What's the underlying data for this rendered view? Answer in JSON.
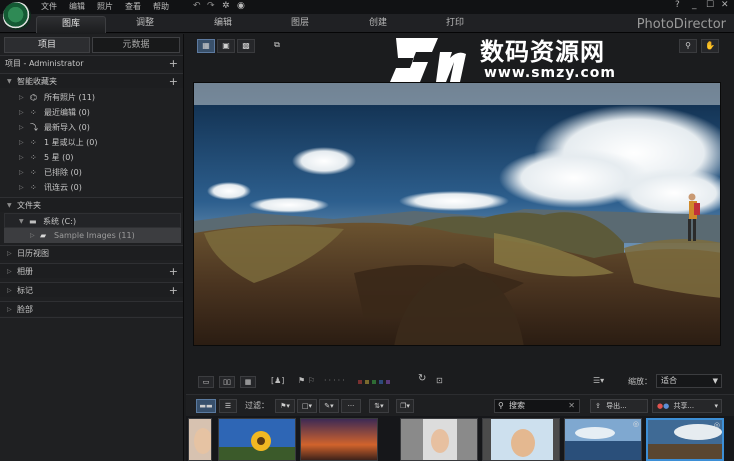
{
  "menubar": {
    "items": [
      "文件",
      "编辑",
      "照片",
      "查看",
      "帮助"
    ],
    "window_buttons": [
      "?",
      "_",
      "☐",
      "✕"
    ]
  },
  "tabs": {
    "items": [
      "图库",
      "调整",
      "编辑",
      "图层",
      "创建",
      "打印"
    ],
    "active": "图库"
  },
  "app_title": "PhotoDirector",
  "left_panel": {
    "tabs": [
      "项目",
      "元数据"
    ],
    "project_header": "项目 - Administrator",
    "smart_collections_header": "智能收藏夹",
    "smart_collections": [
      {
        "label": "所有照片 (11)",
        "icon": "hierarchy-icon"
      },
      {
        "label": "最近编辑 (0)",
        "icon": "smart-icon"
      },
      {
        "label": "最新导入 (0)",
        "icon": "import-icon"
      },
      {
        "label": "1 星或以上 (0)",
        "icon": "smart-icon"
      },
      {
        "label": "5 星 (0)",
        "icon": "smart-icon"
      },
      {
        "label": "已排除 (0)",
        "icon": "smart-icon"
      },
      {
        "label": "讯连云 (0)",
        "icon": "smart-icon"
      }
    ],
    "folders_header": "文件夹",
    "folder_system": "系统 (C:)",
    "folder_sample": "Sample Images (11)",
    "calendar_view": "日历视图",
    "albums": "相册",
    "tags": "标记",
    "faces": "脸部"
  },
  "bottom_toolbar": {
    "zoom_label": "缩放：",
    "zoom_value": "适合",
    "color_swatches": [
      "#7a3030",
      "#7a6a2e",
      "#2e6b34",
      "#2e4a7a",
      "#5b3a7a"
    ]
  },
  "filter_bar": {
    "filter_label": "过滤：",
    "search_placeholder": "搜索",
    "export_label": "导出...",
    "share_label": "共享..."
  },
  "watermark": {
    "title": "数码资源网",
    "url": "www.smzy.com"
  }
}
